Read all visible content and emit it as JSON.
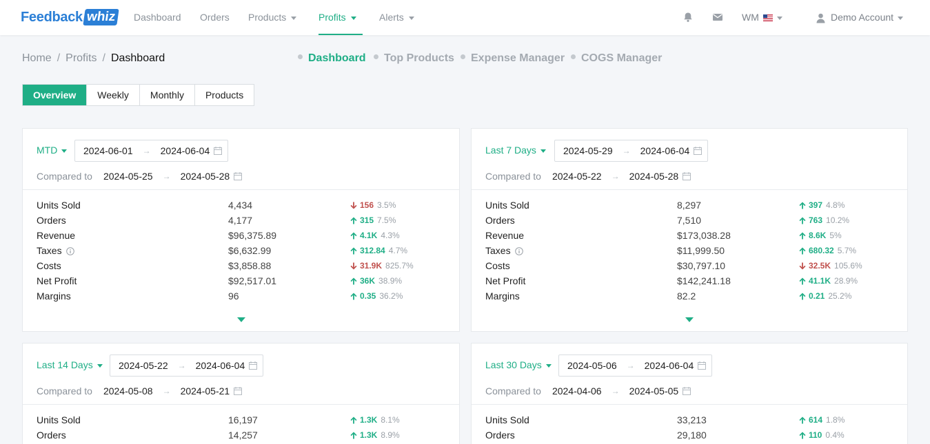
{
  "app": {
    "logo_text": "Feedback",
    "logo_box": "whiz"
  },
  "nav": {
    "items": [
      {
        "label": "Dashboard"
      },
      {
        "label": "Orders"
      },
      {
        "label": "Products"
      },
      {
        "label": "Profits"
      },
      {
        "label": "Alerts"
      }
    ],
    "marketplace": "WM",
    "account": "Demo Account"
  },
  "breadcrumb": {
    "home": "Home",
    "section": "Profits",
    "current": "Dashboard",
    "sep": "/"
  },
  "subnav": [
    "Dashboard",
    "Top Products",
    "Expense Manager",
    "COGS Manager"
  ],
  "tabs": [
    "Overview",
    "Weekly",
    "Monthly",
    "Products"
  ],
  "labels": {
    "compared_to": "Compared to",
    "arrow": "→",
    "metrics": [
      "Units Sold",
      "Orders",
      "Revenue",
      "Taxes",
      "Costs",
      "Net Profit",
      "Margins"
    ]
  },
  "colors": {
    "accent": "#1fae86",
    "down": "#c0504d",
    "brand": "#2b7fd6"
  },
  "cards": [
    {
      "period": "MTD",
      "start": "2024-06-01",
      "end": "2024-06-04",
      "cmp_start": "2024-05-25",
      "cmp_end": "2024-05-28",
      "values": [
        "4,434",
        "4,177",
        "$96,375.89",
        "$6,632.99",
        "$3,858.88",
        "$92,517.01",
        "96"
      ],
      "changes": [
        {
          "dir": "down",
          "amount": "156",
          "pct": "3.5%"
        },
        {
          "dir": "up",
          "amount": "315",
          "pct": "7.5%"
        },
        {
          "dir": "up",
          "amount": "4.1K",
          "pct": "4.3%"
        },
        {
          "dir": "up",
          "amount": "312.84",
          "pct": "4.7%"
        },
        {
          "dir": "down",
          "amount": "31.9K",
          "pct": "825.7%"
        },
        {
          "dir": "up",
          "amount": "36K",
          "pct": "38.9%"
        },
        {
          "dir": "up",
          "amount": "0.35",
          "pct": "36.2%"
        }
      ]
    },
    {
      "period": "Last 7 Days",
      "start": "2024-05-29",
      "end": "2024-06-04",
      "cmp_start": "2024-05-22",
      "cmp_end": "2024-05-28",
      "values": [
        "8,297",
        "7,510",
        "$173,038.28",
        "$11,999.50",
        "$30,797.10",
        "$142,241.18",
        "82.2"
      ],
      "changes": [
        {
          "dir": "up",
          "amount": "397",
          "pct": "4.8%"
        },
        {
          "dir": "up",
          "amount": "763",
          "pct": "10.2%"
        },
        {
          "dir": "up",
          "amount": "8.6K",
          "pct": "5%"
        },
        {
          "dir": "up",
          "amount": "680.32",
          "pct": "5.7%"
        },
        {
          "dir": "down",
          "amount": "32.5K",
          "pct": "105.6%"
        },
        {
          "dir": "up",
          "amount": "41.1K",
          "pct": "28.9%"
        },
        {
          "dir": "up",
          "amount": "0.21",
          "pct": "25.2%"
        }
      ]
    },
    {
      "period": "Last 14 Days",
      "start": "2024-05-22",
      "end": "2024-06-04",
      "cmp_start": "2024-05-08",
      "cmp_end": "2024-05-21",
      "values": [
        "16,197",
        "14,257"
      ],
      "changes": [
        {
          "dir": "up",
          "amount": "1.3K",
          "pct": "8.1%"
        },
        {
          "dir": "up",
          "amount": "1.3K",
          "pct": "8.9%"
        }
      ]
    },
    {
      "period": "Last 30 Days",
      "start": "2024-05-06",
      "end": "2024-06-04",
      "cmp_start": "2024-04-06",
      "cmp_end": "2024-05-05",
      "values": [
        "33,213",
        "29,180"
      ],
      "changes": [
        {
          "dir": "up",
          "amount": "614",
          "pct": "1.8%"
        },
        {
          "dir": "up",
          "amount": "110",
          "pct": "0.4%"
        }
      ]
    }
  ]
}
